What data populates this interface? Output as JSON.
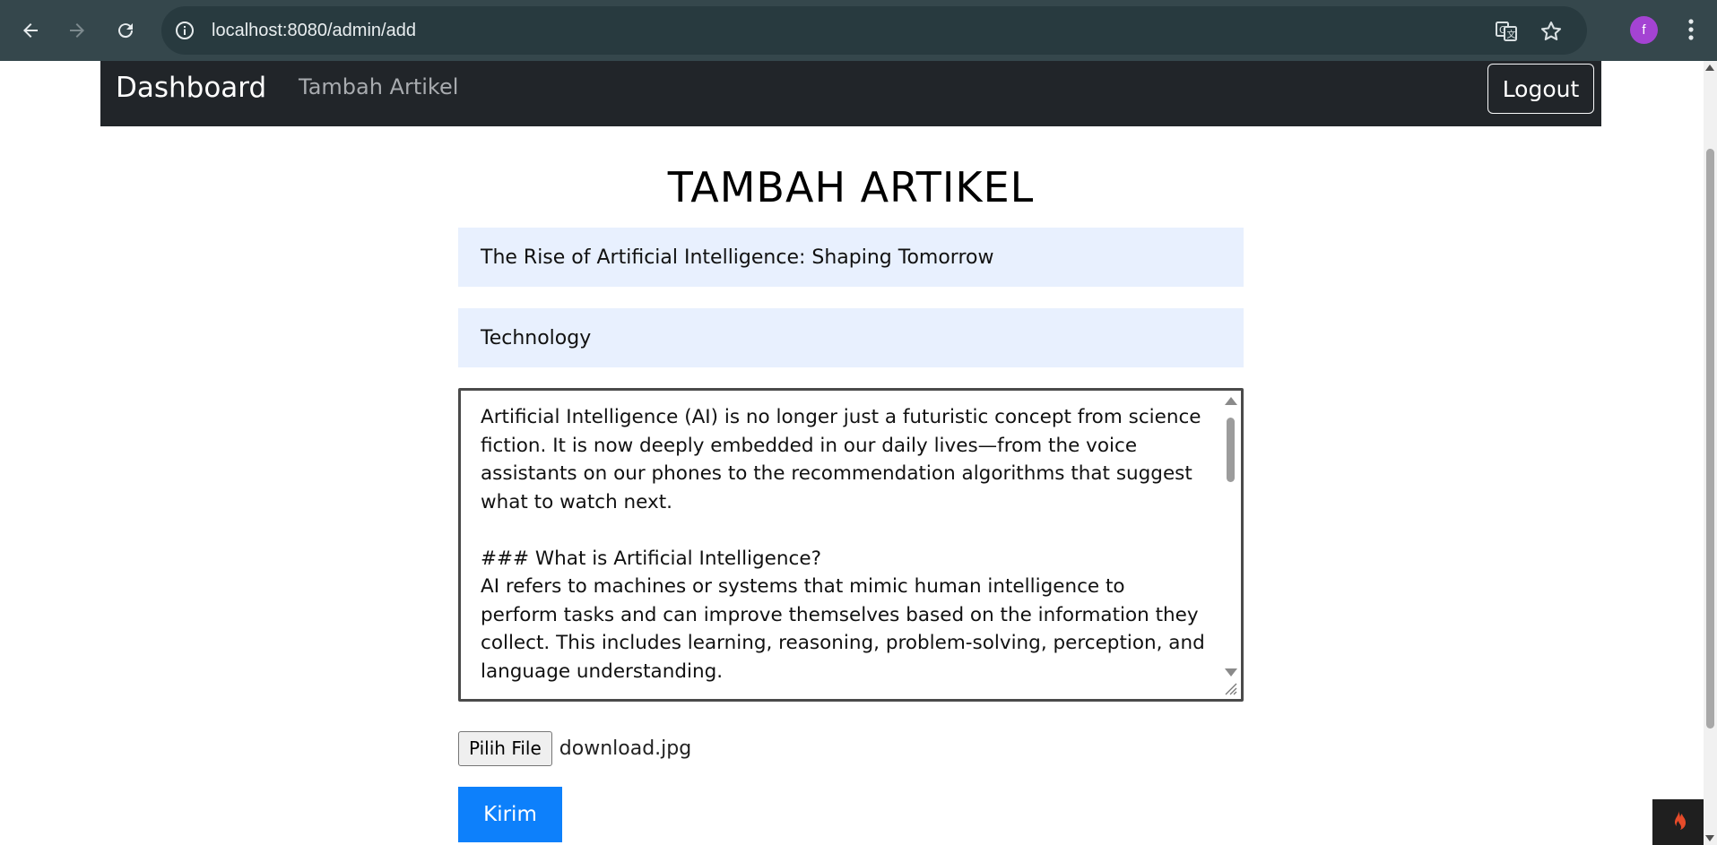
{
  "browser": {
    "url": "localhost:8080/admin/add",
    "profile_initial": "f",
    "icons": [
      "back-icon",
      "forward-icon",
      "reload-icon",
      "info-icon",
      "translate-icon",
      "star-icon",
      "menu-dots-icon"
    ]
  },
  "navbar": {
    "brand": "Dashboard",
    "link": "Tambah Artikel",
    "logout_label": "Logout"
  },
  "page": {
    "title": "TAMBAH ARTIKEL"
  },
  "form": {
    "title_value": "The Rise of Artificial Intelligence: Shaping Tomorrow",
    "category_value": "Technology",
    "content_value": "Artificial Intelligence (AI) is no longer just a futuristic concept from science fiction. It is now deeply embedded in our daily lives—from the voice assistants on our phones to the recommendation algorithms that suggest what to watch next.\n\n### What is Artificial Intelligence?\nAI refers to machines or systems that mimic human intelligence to perform tasks and can improve themselves based on the information they collect. This includes learning, reasoning, problem-solving, perception, and language understanding.",
    "file_button_label": "Pilih File",
    "file_name": "download.jpg",
    "submit_label": "Kirim"
  },
  "colors": {
    "navbar_bg": "#212529",
    "input_bg": "#e8f0fe",
    "submit_bg": "#0d80fb",
    "chrome_bg": "#35474c",
    "avatar_bg": "#a443d3"
  }
}
